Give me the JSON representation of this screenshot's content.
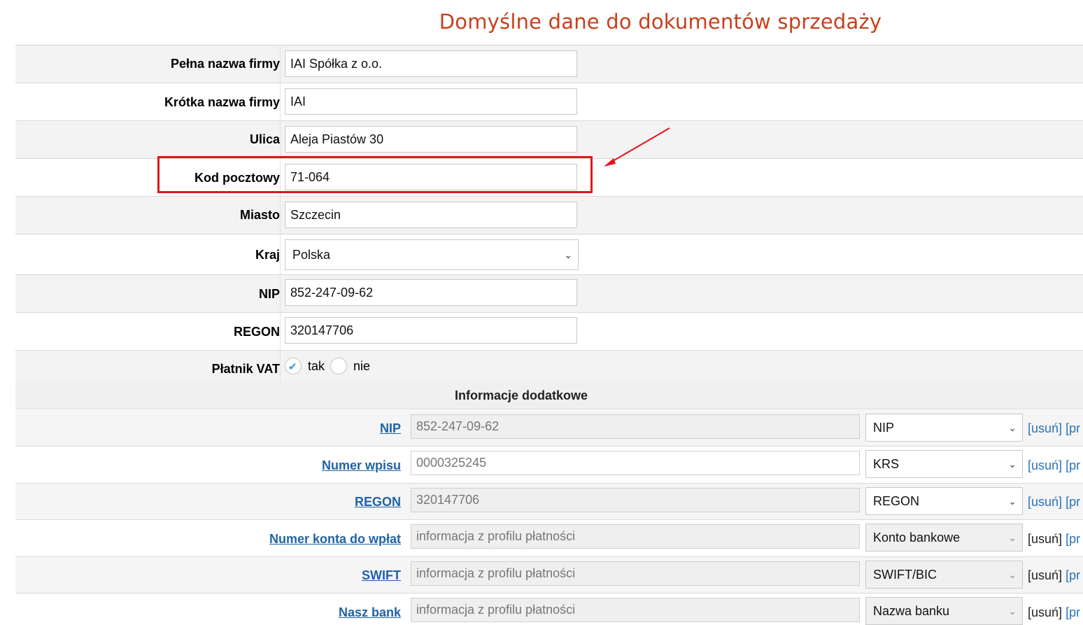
{
  "page_title": "Domyślne dane do dokumentów sprzedaży",
  "fields": {
    "full_name": {
      "label": "Pełna nazwa firmy",
      "value": "IAI Spółka z o.o."
    },
    "short_name": {
      "label": "Krótka nazwa firmy",
      "value": "IAI"
    },
    "street": {
      "label": "Ulica",
      "value": "Aleja Piastów 30"
    },
    "postal_code": {
      "label": "Kod pocztowy",
      "value": "71-064"
    },
    "city": {
      "label": "Miasto",
      "value": "Szczecin"
    },
    "country": {
      "label": "Kraj",
      "value": "Polska"
    },
    "nip": {
      "label": "NIP",
      "value": "852-247-09-62"
    },
    "regon": {
      "label": "REGON",
      "value": "320147706"
    },
    "vat_payer": {
      "label": "Płatnik VAT",
      "yes_label": "tak",
      "no_label": "nie",
      "selected": "tak"
    }
  },
  "additional": {
    "title": "Informacje dodatkowe",
    "delete_label": "[usuń]",
    "rows": [
      {
        "label": "NIP",
        "value": "852-247-09-62",
        "type": "NIP"
      },
      {
        "label": "Numer wpisu",
        "value": "0000325245",
        "type": "KRS"
      },
      {
        "label": "REGON",
        "value": "320147706",
        "type": "REGON"
      },
      {
        "label": "Numer konta do wpłat",
        "value": "informacja z profilu płatności",
        "type": "Konto bankowe"
      },
      {
        "label": "SWIFT",
        "value": "informacja z profilu płatności",
        "type": "SWIFT/BIC"
      },
      {
        "label": "Nasz bank",
        "value": "informacja z profilu płatności",
        "type": "Nazwa banku"
      }
    ],
    "extra_link": "[pr"
  },
  "colors": {
    "title": "#c8401c",
    "highlight": "#e3141b",
    "link": "#1f63a6"
  }
}
